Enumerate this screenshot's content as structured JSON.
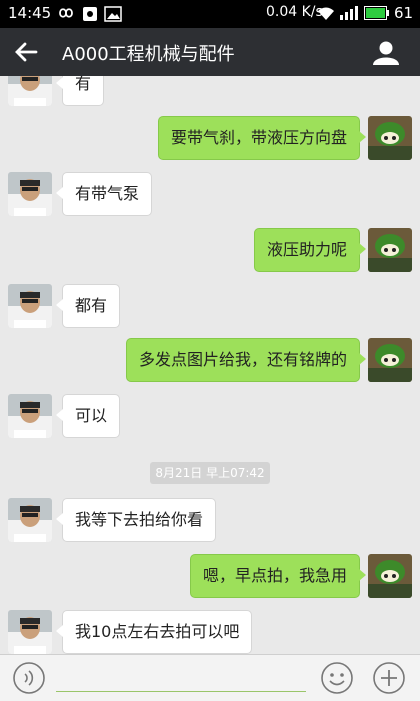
{
  "status": {
    "time": "14:45",
    "net": "0.04 K/s",
    "battery": "61"
  },
  "header": {
    "title": "A000工程机械与配件"
  },
  "messages": [
    {
      "side": "left",
      "text": "有"
    },
    {
      "side": "right",
      "text": "要带气刹，带液压方向盘"
    },
    {
      "side": "left",
      "text": "有带气泵"
    },
    {
      "side": "right",
      "text": "液压助力呢"
    },
    {
      "side": "left",
      "text": "都有"
    },
    {
      "side": "right",
      "text": "多发点图片给我，还有铭牌的"
    },
    {
      "side": "left",
      "text": "可以"
    },
    {
      "side": "left",
      "text": "我等下去拍给你看"
    },
    {
      "side": "right",
      "text": "嗯，早点拍，我急用"
    },
    {
      "side": "left",
      "text": "我10点左右去拍可以吧"
    }
  ],
  "timestamp": "8月21日 早上07:42",
  "colors": {
    "bubble_right": "#9de05a",
    "bubble_left": "#ffffff",
    "appbar": "#2d2f33",
    "background": "#e9e9e9"
  },
  "icons": {
    "back": "arrow-left-icon",
    "contact": "person-icon",
    "voice": "voice-icon",
    "emoji": "emoji-icon",
    "plus": "plus-icon"
  }
}
